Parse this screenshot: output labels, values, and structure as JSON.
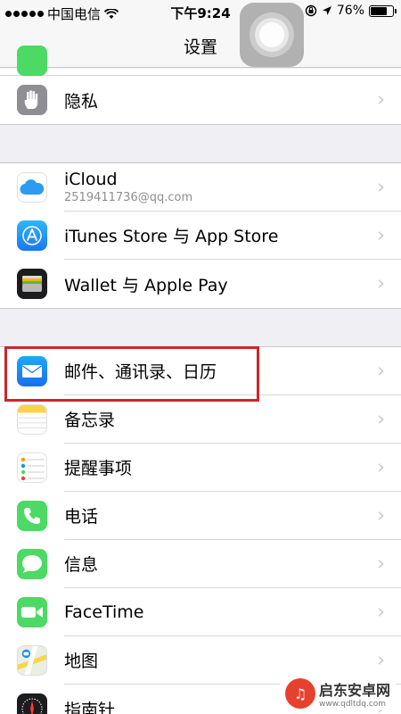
{
  "status_bar": {
    "carrier": "中国电信",
    "time": "下午9:24",
    "battery_percent": "76%",
    "battery_level": 0.76
  },
  "nav": {
    "title": "设置"
  },
  "groups": [
    {
      "rows": [
        {
          "id": "privacy",
          "label": "隐私",
          "icon": "hand-icon",
          "color": "#8e8e93"
        }
      ]
    },
    {
      "rows": [
        {
          "id": "icloud",
          "label": "iCloud",
          "sublabel": "2519411736@qq.com",
          "icon": "cloud-icon",
          "color": "#ffffff"
        },
        {
          "id": "itunes",
          "label": "iTunes Store 与 App Store",
          "icon": "app-store-icon",
          "color": "#1a8ef5"
        },
        {
          "id": "wallet",
          "label": "Wallet 与 Apple Pay",
          "icon": "wallet-icon",
          "color": "#1c1c1e"
        }
      ]
    },
    {
      "rows": [
        {
          "id": "mail",
          "label": "邮件、通讯录、日历",
          "icon": "mail-icon",
          "color": "#1a8ef5"
        },
        {
          "id": "notes",
          "label": "备忘录",
          "icon": "notes-icon",
          "color": "#ffffff"
        },
        {
          "id": "reminders",
          "label": "提醒事项",
          "icon": "reminders-icon",
          "color": "#ffffff"
        },
        {
          "id": "phone",
          "label": "电话",
          "icon": "phone-icon",
          "color": "#4cd964"
        },
        {
          "id": "messages",
          "label": "信息",
          "icon": "messages-icon",
          "color": "#4cd964"
        },
        {
          "id": "facetime",
          "label": "FaceTime",
          "icon": "facetime-icon",
          "color": "#4cd964"
        },
        {
          "id": "maps",
          "label": "地图",
          "icon": "maps-icon",
          "color": "#e8e8e8"
        },
        {
          "id": "compass",
          "label": "指南针",
          "icon": "compass-icon",
          "color": "#1c1c1e"
        }
      ]
    }
  ],
  "watermark": {
    "title": "启东安卓网",
    "url": "www.qdltdq.com"
  },
  "accent": "#c9282d"
}
